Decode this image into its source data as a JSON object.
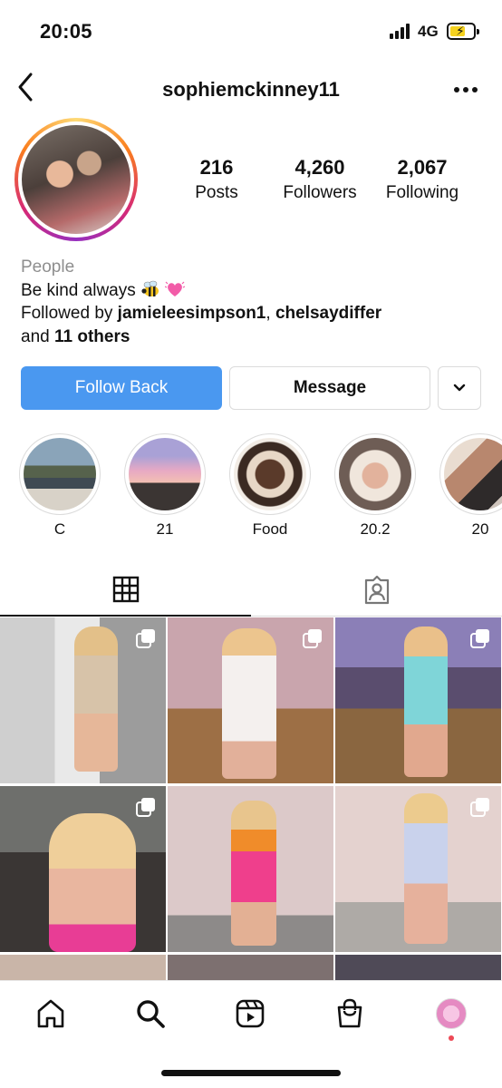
{
  "status_bar": {
    "time": "20:05",
    "network": "4G",
    "battery_level": 0.5,
    "battery_color": "#f5d21f"
  },
  "header": {
    "username": "sophiemckinney11",
    "back_icon": "chevron-left-icon",
    "more_icon": "more-horizontal-icon"
  },
  "profile": {
    "stats": [
      {
        "value": "216",
        "label": "Posts"
      },
      {
        "value": "4,260",
        "label": "Followers"
      },
      {
        "value": "2,067",
        "label": "Following"
      }
    ],
    "category": "People",
    "bio": "Be kind always",
    "bio_emojis": [
      "bee-emoji",
      "pink-heart-emoji"
    ],
    "followed_by_prefix": "Followed by ",
    "followed_by_user1": "jamieleesimpson1",
    "followed_by_sep": ", ",
    "followed_by_user2": "chelsaydiffer",
    "followed_by_and": "and ",
    "followed_by_others": "11 others"
  },
  "actions": {
    "follow_back": "Follow Back",
    "message": "Message",
    "more_icon": "chevron-down-icon",
    "accent_color": "#4a98f0"
  },
  "highlights": [
    {
      "label": "C"
    },
    {
      "label": "21"
    },
    {
      "label": "Food"
    },
    {
      "label": "20.2"
    },
    {
      "label": "20"
    }
  ],
  "tabs": [
    {
      "icon": "grid-icon",
      "active": true
    },
    {
      "icon": "tagged-person-icon",
      "active": false
    }
  ],
  "posts_icon_multi": "multiple-photos-icon",
  "bottom_nav": [
    "home-icon",
    "search-icon",
    "reels-icon",
    "shop-icon",
    "profile-avatar"
  ]
}
